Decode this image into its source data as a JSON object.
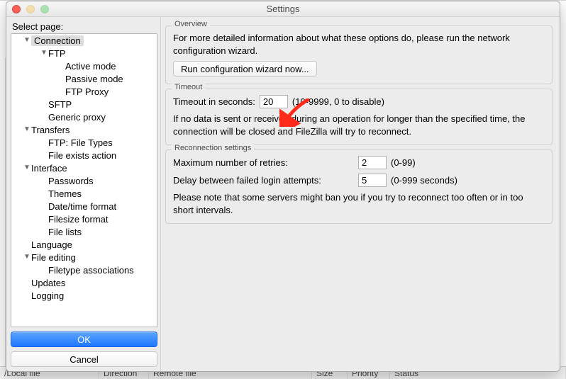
{
  "window": {
    "title": "Settings"
  },
  "sidebar": {
    "label": "Select page:",
    "items": [
      {
        "label": "Connection",
        "depth": 0,
        "disclosure": true,
        "selected": true
      },
      {
        "label": "FTP",
        "depth": 1,
        "disclosure": true
      },
      {
        "label": "Active mode",
        "depth": 2
      },
      {
        "label": "Passive mode",
        "depth": 2
      },
      {
        "label": "FTP Proxy",
        "depth": 2
      },
      {
        "label": "SFTP",
        "depth": 1
      },
      {
        "label": "Generic proxy",
        "depth": 1
      },
      {
        "label": "Transfers",
        "depth": 0,
        "disclosure": true
      },
      {
        "label": "FTP: File Types",
        "depth": 1
      },
      {
        "label": "File exists action",
        "depth": 1
      },
      {
        "label": "Interface",
        "depth": 0,
        "disclosure": true
      },
      {
        "label": "Passwords",
        "depth": 1
      },
      {
        "label": "Themes",
        "depth": 1
      },
      {
        "label": "Date/time format",
        "depth": 1
      },
      {
        "label": "Filesize format",
        "depth": 1
      },
      {
        "label": "File lists",
        "depth": 1
      },
      {
        "label": "Language",
        "depth": 0
      },
      {
        "label": "File editing",
        "depth": 0,
        "disclosure": true
      },
      {
        "label": "Filetype associations",
        "depth": 1
      },
      {
        "label": "Updates",
        "depth": 0
      },
      {
        "label": "Logging",
        "depth": 0
      }
    ],
    "ok_label": "OK",
    "cancel_label": "Cancel"
  },
  "overview": {
    "title": "Overview",
    "text": "For more detailed information about what these options do, please run the network configuration wizard.",
    "wizard_button": "Run configuration wizard now..."
  },
  "timeout": {
    "title": "Timeout",
    "label": "Timeout in seconds:",
    "value": "20",
    "range_hint": "(10-9999, 0 to disable)",
    "explain": "If no data is sent or received during an operation for longer than the specified time, the connection will be closed and FileZilla will try to reconnect."
  },
  "reconnect": {
    "title": "Reconnection settings",
    "retries_label": "Maximum number of retries:",
    "retries_value": "2",
    "retries_hint": "(0-99)",
    "delay_label": "Delay between failed login attempts:",
    "delay_value": "5",
    "delay_hint": "(0-999 seconds)",
    "note": "Please note that some servers might ban you if you try to reconnect too often or in too short intervals."
  },
  "bg_cols": [
    "/Local file",
    "Direction",
    "Remote file",
    "Size",
    "Priority",
    "Status"
  ]
}
